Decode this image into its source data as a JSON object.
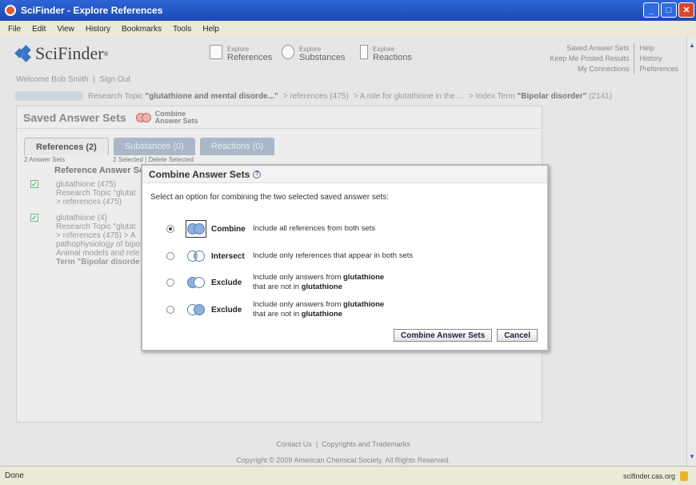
{
  "window": {
    "title": "SciFinder - Explore References"
  },
  "menu": [
    "File",
    "Edit",
    "View",
    "History",
    "Bookmarks",
    "Tools",
    "Help"
  ],
  "header": {
    "logo": "SciFinder",
    "nav": [
      {
        "small": "Explore",
        "label": "References"
      },
      {
        "small": "Explore",
        "label": "Substances"
      },
      {
        "small": "Explore",
        "label": "Reactions"
      }
    ],
    "right_links": {
      "col1": [
        "Saved Answer Sets",
        "Keep Me Posted Results",
        "My Connections"
      ],
      "col2": [
        "Help",
        "History",
        "Preferences"
      ]
    },
    "welcome": "Welcome Bob Smith",
    "sign_out": "Sign Out"
  },
  "breadcrumb": {
    "topic_prefix": "Research Topic ",
    "topic": "\"glutathione and mental disorde...\"",
    "refs": "> references (475)",
    "role": "> A role for glutathione in the ...",
    "index_prefix": "> Index Term ",
    "index_term": "\"Bipolar disorder\"",
    "count": "(2141)"
  },
  "panel": {
    "title": "Saved Answer Sets",
    "combine_line1": "Combine",
    "combine_line2": "Answer Sets",
    "tabs": [
      "References (2)",
      "Substances (0)",
      "Reactions (0)"
    ],
    "answer_sets": "2 Answer Sets",
    "selected": "2 Selected",
    "delete": "Delete Selected",
    "col_header": "Reference Answer Se",
    "entries": [
      {
        "title": "glutathione (475)",
        "l2": "Research Topic \"glutat",
        "l3": "> references (475)"
      },
      {
        "title": "glutathione (4)",
        "l2": "Research Topic \"glutat",
        "l3": "> references (475) > A",
        "l4": "pathophysiology of bipol",
        "l5": "Animal models and rele",
        "l6": "Term \"Bipolar disorde"
      }
    ]
  },
  "modal": {
    "title": "Combine Answer Sets",
    "prompt": "Select an option for combining the two selected saved answer sets:",
    "options": [
      {
        "name": "Combine",
        "desc1": "Include all references from both sets"
      },
      {
        "name": "Intersect",
        "desc1": "Include only references that appear in both sets"
      },
      {
        "name": "Exclude",
        "desc1": "Include only answers from ",
        "bold1": "glutathione",
        "desc2": "that are not in ",
        "bold2": "glutathione"
      },
      {
        "name": "Exclude",
        "desc1": "Include only answers from ",
        "bold1": "glutathione",
        "desc2": "that are not in ",
        "bold2": "glutathione"
      }
    ],
    "combine_button": "Combine Answer Sets",
    "cancel_button": "Cancel"
  },
  "footer": {
    "contact": "Contact Us",
    "copyrights": "Copyrights and Trademarks",
    "copyright": "Copyright © 2009 American Chemical Society. All Rights Reserved."
  },
  "status": {
    "text": "Done",
    "url": "scifinder.cas.org"
  }
}
